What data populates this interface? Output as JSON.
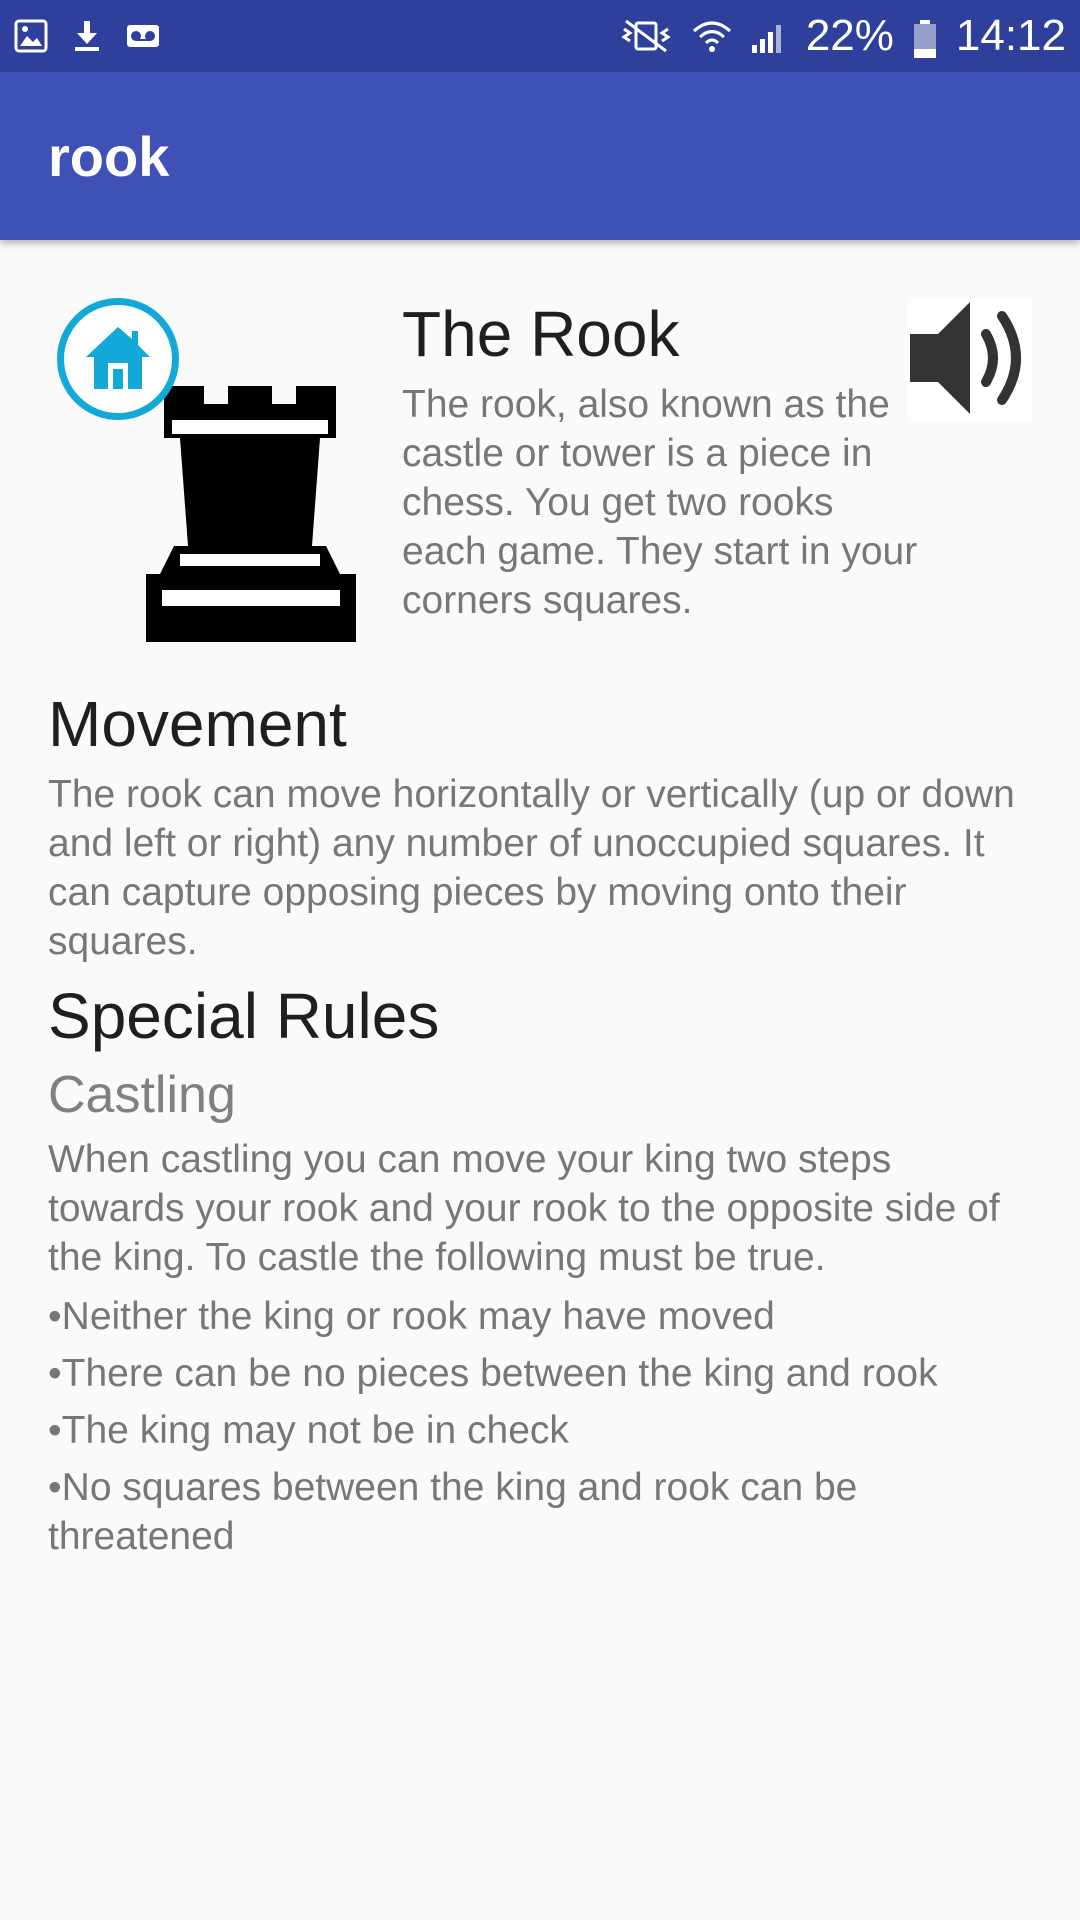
{
  "status_bar": {
    "icons_left": [
      "gallery-icon",
      "download-icon",
      "voicemail-icon"
    ],
    "icons_right": [
      "vibrate-mute-icon",
      "wifi-icon",
      "signal-icon",
      "battery-icon"
    ],
    "battery": "22%",
    "time": "14:12"
  },
  "app_bar": {
    "title": "rook",
    "color": "#3f51b5"
  },
  "header": {
    "home_icon": "home-icon",
    "home_color": "#12a9d8",
    "piece_icon": "rook-chess-piece",
    "sound_icon": "speaker-icon",
    "title": "The Rook",
    "intro": "The rook, also known as the castle or tower is a piece in chess.  You get two rooks each game.  They start in your corners squares."
  },
  "movement": {
    "heading": "Movement",
    "text": "The rook can move horizontally or vertically (up or down and left or right) any number of unoccupied squares.  It can capture opposing pieces by moving onto their squares."
  },
  "special_rules": {
    "heading": "Special Rules",
    "castling_heading": "Castling",
    "castling_text": "When castling you can move your king two steps towards your rook and your rook to the opposite side of the king.  To castle the following must be true.",
    "rules": [
      "•Neither the king or rook may have moved",
      "•There can be no pieces between the king and rook",
      "•The king may not be in check",
      "•No squares between the king and rook can be threatened"
    ]
  }
}
